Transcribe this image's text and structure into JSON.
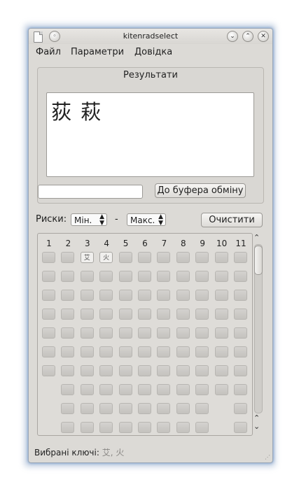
{
  "window": {
    "title": "kitenradselect",
    "min_glyph": "⌄",
    "max_glyph": "⌃",
    "close_glyph": "✕",
    "shade_glyph": "◦"
  },
  "menu": {
    "file": "Файл",
    "settings": "Параметри",
    "help": "Довідка"
  },
  "results": {
    "title": "Результати",
    "kanji": "荻 萩",
    "input_value": "",
    "copy_button": "До буфера обміну"
  },
  "strokes": {
    "label": "Риски:",
    "min": "Мін.",
    "separator": "-",
    "max": "Макс.",
    "clear_button": "Очистити"
  },
  "grid": {
    "columns": [
      "1",
      "2",
      "3",
      "4",
      "5",
      "6",
      "7",
      "8",
      "9",
      "10",
      "11"
    ],
    "selected": [
      "艾",
      "火"
    ]
  },
  "status": {
    "label": "Вибрані ключі:",
    "keys": "艾, 火"
  },
  "colors": {
    "window_bg": "#dcdad6",
    "border_glow": "#6a8fc0",
    "key_disabled": "#c8c6c2",
    "key_selected": "#f0efed"
  }
}
